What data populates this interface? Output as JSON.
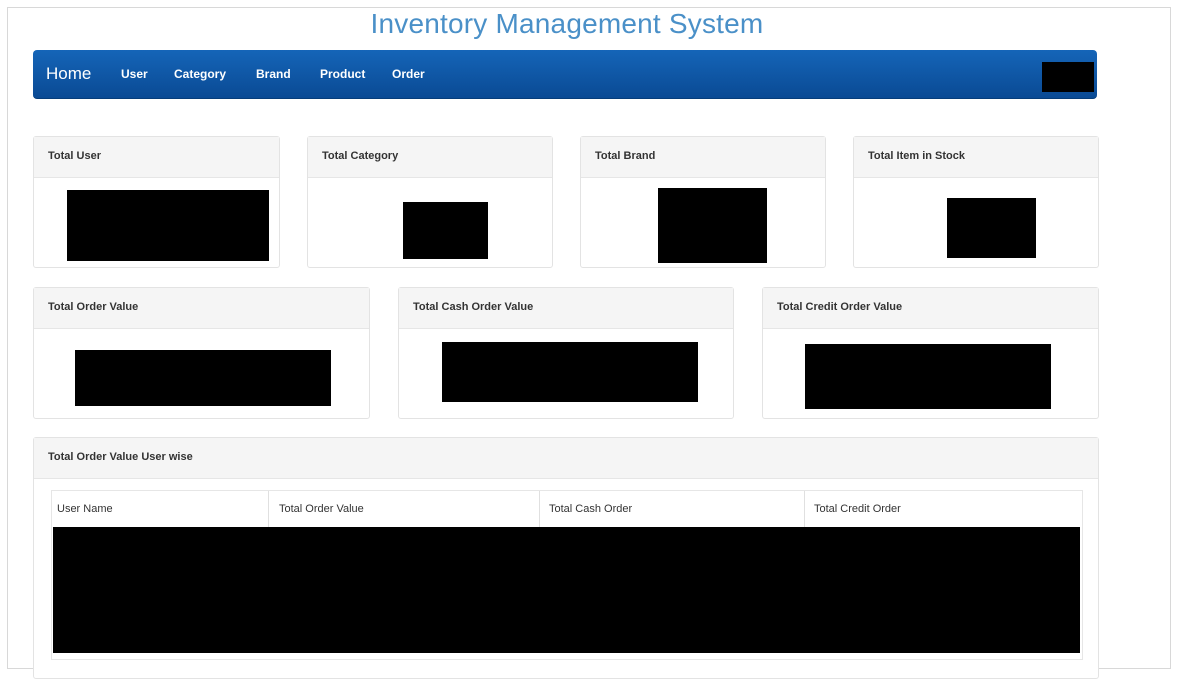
{
  "header": {
    "title": "Inventory Management System"
  },
  "navbar": {
    "brand": "Home",
    "items": [
      {
        "label": "User"
      },
      {
        "label": "Category"
      },
      {
        "label": "Brand"
      },
      {
        "label": "Product"
      },
      {
        "label": "Order"
      }
    ]
  },
  "stats_row1": [
    {
      "title": "Total User"
    },
    {
      "title": "Total Category"
    },
    {
      "title": "Total Brand"
    },
    {
      "title": "Total Item in Stock"
    }
  ],
  "stats_row2": [
    {
      "title": "Total Order Value"
    },
    {
      "title": "Total Cash Order Value"
    },
    {
      "title": "Total Credit Order Value"
    }
  ],
  "user_orders": {
    "title": "Total Order Value User wise",
    "columns": [
      "User Name",
      "Total Order Value",
      "Total Cash Order",
      "Total Credit Order"
    ]
  },
  "colors": {
    "title_text": "#4a90c8",
    "navbar": "#0d52a0",
    "panel_header": "#f5f5f5",
    "redaction": "#000000"
  }
}
